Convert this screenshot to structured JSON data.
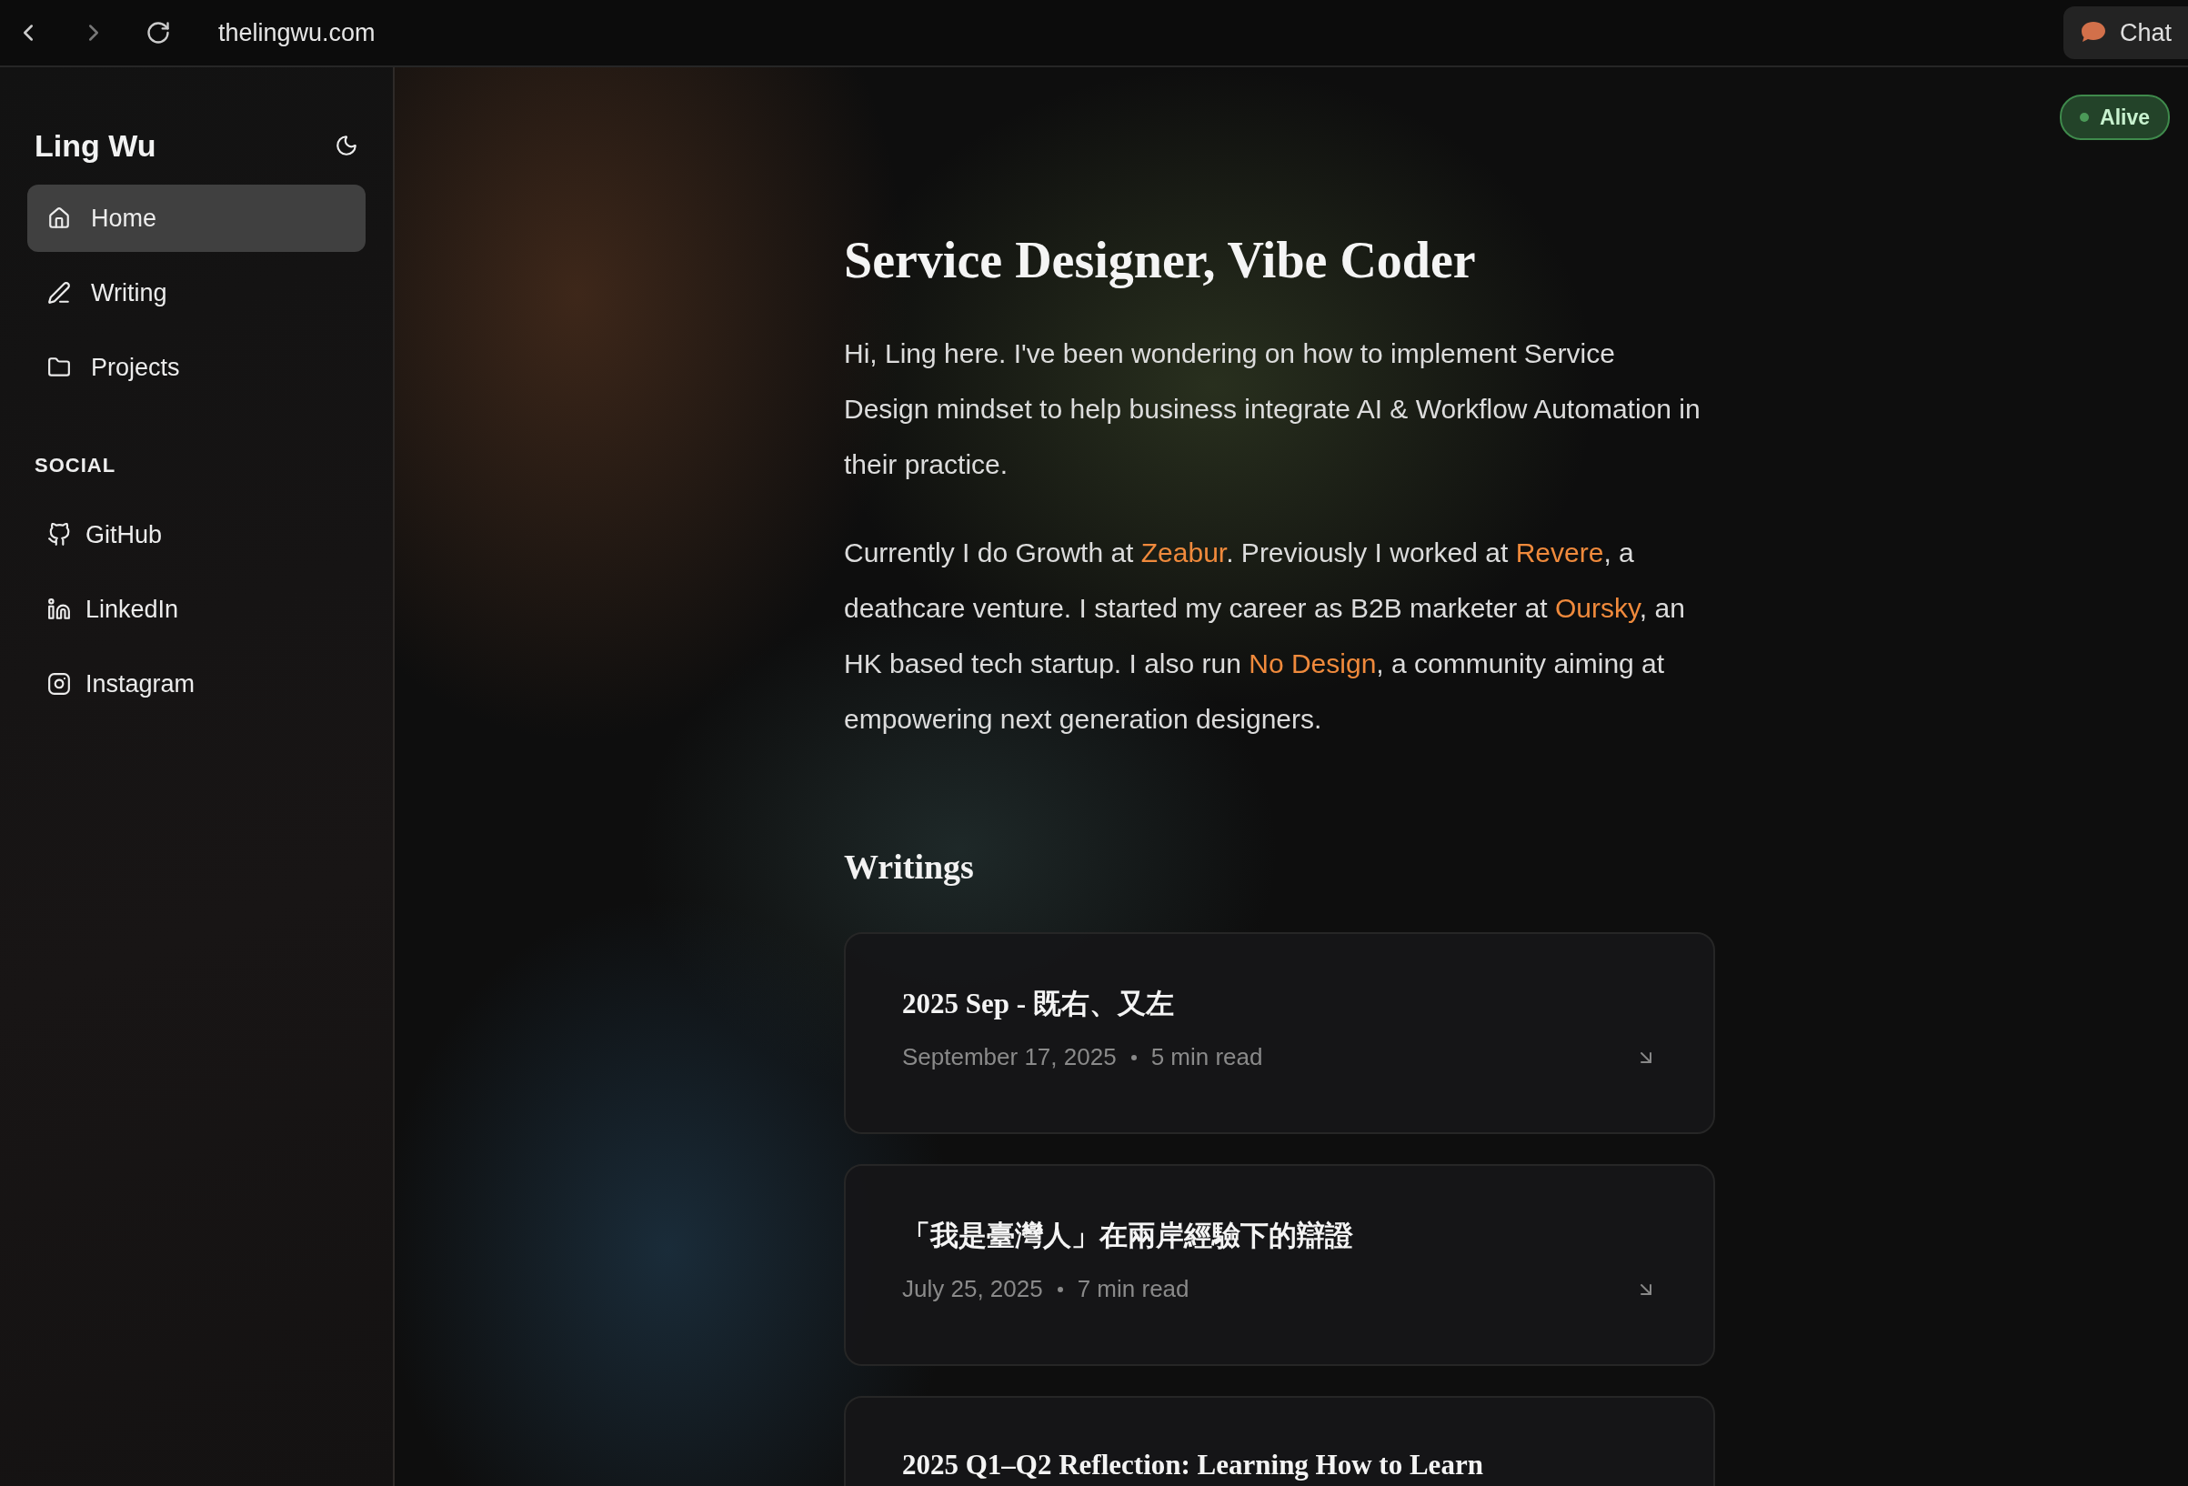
{
  "browser": {
    "url": "thelingwu.com",
    "chat_button": "Chat"
  },
  "sidebar": {
    "title": "Ling Wu",
    "nav": [
      {
        "label": "Home",
        "selected": true
      },
      {
        "label": "Writing",
        "selected": false
      },
      {
        "label": "Projects",
        "selected": false
      }
    ],
    "social_heading": "SOCIAL",
    "social": [
      {
        "label": "GitHub"
      },
      {
        "label": "LinkedIn"
      },
      {
        "label": "Instagram"
      }
    ]
  },
  "status_badge": "Alive",
  "hero": {
    "title": "Service Designer, Vibe Coder",
    "paragraphs": [
      [
        {
          "kind": "text",
          "text": "Hi, Ling here. I've been wondering on how to implement Service Design mindset to help business integrate AI & Workflow Automation in their practice."
        }
      ],
      [
        {
          "kind": "text",
          "text": "Currently I do Growth at "
        },
        {
          "kind": "link",
          "text": "Zeabur"
        },
        {
          "kind": "text",
          "text": ". Previously I worked at "
        },
        {
          "kind": "link",
          "text": "Revere"
        },
        {
          "kind": "text",
          "text": ", a deathcare venture. I started my career as B2B marketer at "
        },
        {
          "kind": "link",
          "text": "Oursky"
        },
        {
          "kind": "text",
          "text": ", an HK based tech startup. I also run "
        },
        {
          "kind": "link",
          "text": "No Design"
        },
        {
          "kind": "text",
          "text": ", a community aiming at empowering next generation designers."
        }
      ]
    ]
  },
  "writings": {
    "heading": "Writings",
    "items": [
      {
        "title": "2025 Sep - 既右、又左",
        "date": "September 17, 2025",
        "read_time": "5 min read"
      },
      {
        "title": "「我是臺灣人」在兩岸經驗下的辯證",
        "date": "July 25, 2025",
        "read_time": "7 min read"
      },
      {
        "title": "2025 Q1–Q2 Reflection: Learning How to Learn"
      }
    ]
  }
}
